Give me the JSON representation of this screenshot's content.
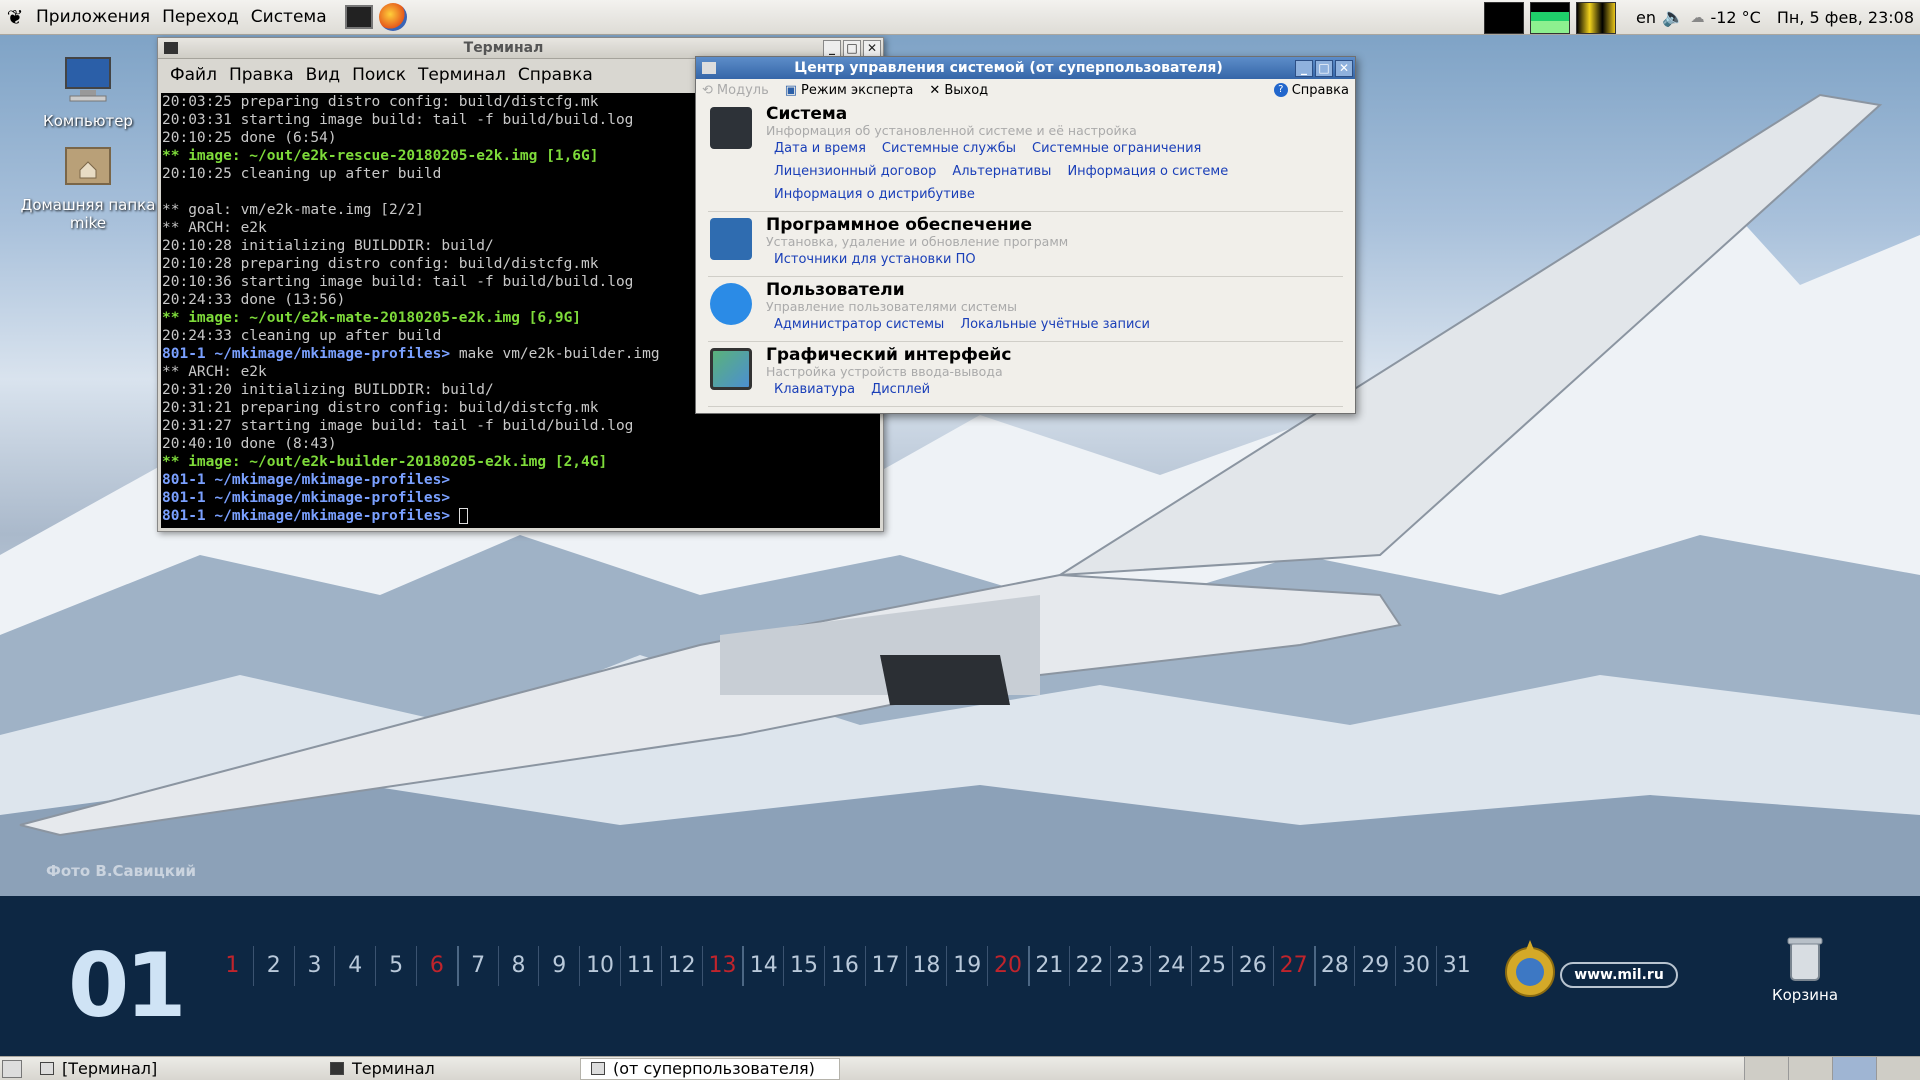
{
  "top_panel": {
    "menus": [
      "Приложения",
      "Переход",
      "Система"
    ],
    "lang": "en",
    "weather": "-12 °C",
    "datetime": "Пн,  5 фев, 23:08"
  },
  "desktop": {
    "icons": [
      {
        "label": "Компьютер"
      },
      {
        "label": "Домашняя папка mike"
      }
    ],
    "watermark": "Фото В.Савицкий"
  },
  "terminal": {
    "title": "Терминал",
    "menu": [
      "Файл",
      "Правка",
      "Вид",
      "Поиск",
      "Терминал",
      "Справка"
    ],
    "lines": [
      {
        "t": "20:03:25 preparing distro config: build/distcfg.mk",
        "c": "c-dim"
      },
      {
        "t": "20:03:31 starting image build: tail -f build/build.log",
        "c": "c-dim"
      },
      {
        "t": "20:10:25 done (6:54)",
        "c": "c-dim"
      },
      {
        "t": "** image: ~/out/e2k-rescue-20180205-e2k.img [1,6G]",
        "c": "c-green"
      },
      {
        "t": "20:10:25 cleaning up after build",
        "c": "c-dim"
      },
      {
        "t": "",
        "c": "c-dim"
      },
      {
        "t": "** goal: vm/e2k-mate.img [2/2]",
        "c": "c-dim"
      },
      {
        "t": "** ARCH: e2k",
        "c": "c-dim"
      },
      {
        "t": "20:10:28 initializing BUILDDIR: build/",
        "c": "c-dim"
      },
      {
        "t": "20:10:28 preparing distro config: build/distcfg.mk",
        "c": "c-dim"
      },
      {
        "t": "20:10:36 starting image build: tail -f build/build.log",
        "c": "c-dim"
      },
      {
        "t": "20:24:33 done (13:56)",
        "c": "c-dim"
      },
      {
        "t": "** image: ~/out/e2k-mate-20180205-e2k.img [6,9G]",
        "c": "c-green"
      },
      {
        "t": "20:24:33 cleaning up after build",
        "c": "c-dim"
      },
      {
        "t": "801-1 ~/mkimage/mkimage-profiles>",
        "c": "c-blue",
        "rest": " make vm/e2k-builder.img"
      },
      {
        "t": "** ARCH: e2k",
        "c": "c-dim"
      },
      {
        "t": "20:31:20 initializing BUILDDIR: build/",
        "c": "c-dim"
      },
      {
        "t": "20:31:21 preparing distro config: build/distcfg.mk",
        "c": "c-dim"
      },
      {
        "t": "20:31:27 starting image build: tail -f build/build.log",
        "c": "c-dim"
      },
      {
        "t": "20:40:10 done (8:43)",
        "c": "c-dim"
      },
      {
        "t": "** image: ~/out/e2k-builder-20180205-e2k.img [2,4G]",
        "c": "c-green"
      },
      {
        "t": "801-1 ~/mkimage/mkimage-profiles>",
        "c": "c-blue",
        "rest": ""
      },
      {
        "t": "801-1 ~/mkimage/mkimage-profiles>",
        "c": "c-blue",
        "rest": ""
      },
      {
        "t": "801-1 ~/mkimage/mkimage-profiles>",
        "c": "c-blue",
        "rest": " ",
        "cursor": true
      }
    ]
  },
  "control_center": {
    "title": "Центр управления системой (от суперпользователя)",
    "toolbar": {
      "module": "Модуль",
      "expert": "Режим эксперта",
      "exit": "Выход",
      "help": "Справка"
    },
    "sections": [
      {
        "icon": "sliders-icon",
        "title": "Система",
        "desc": "Информация об установленной системе и её настройка",
        "links": [
          "Дата и время",
          "Системные службы",
          "Системные ограничения",
          "Лицензионный договор",
          "Альтернативы",
          "Информация о системе",
          "Информация о дистрибутиве"
        ]
      },
      {
        "icon": "package-icon",
        "title": "Программное обеспечение",
        "desc": "Установка, удаление и обновление программ",
        "links": [
          "Источники для установки ПО"
        ]
      },
      {
        "icon": "users-icon",
        "title": "Пользователи",
        "desc": "Управление пользователями системы",
        "links": [
          "Администратор системы",
          "Локальные учётные записи"
        ]
      },
      {
        "icon": "monitor-icon",
        "title": "Графический интерфейс",
        "desc": "Настройка устройств ввода-вывода",
        "links": [
          "Клавиатура",
          "Дисплей"
        ]
      }
    ]
  },
  "calendar": {
    "month": "01",
    "days": [
      "1",
      "2",
      "3",
      "4",
      "5",
      "6",
      "7",
      "8",
      "9",
      "10",
      "11",
      "12",
      "13",
      "14",
      "15",
      "16",
      "17",
      "18",
      "19",
      "20",
      "21",
      "22",
      "23",
      "24",
      "25",
      "26",
      "27",
      "28",
      "29",
      "30",
      "31"
    ],
    "red_days": [
      "1",
      "6",
      "13",
      "20",
      "27"
    ],
    "site": "www.mil.ru",
    "trash_label": "Корзина"
  },
  "taskbar": {
    "tasks": [
      "[Терминал]",
      "Терминал",
      "(от суперпользователя)"
    ]
  }
}
